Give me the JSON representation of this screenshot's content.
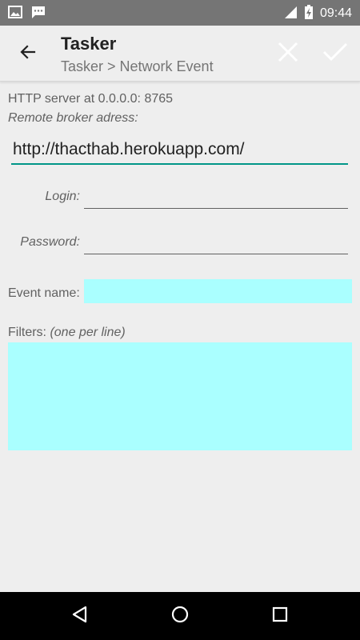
{
  "status_bar": {
    "time": "09:44",
    "left_icons": [
      "image-icon",
      "chat-icon"
    ],
    "right_icons": [
      "signal-icon",
      "battery-charging-icon"
    ]
  },
  "toolbar": {
    "title": "Tasker",
    "subtitle": "Tasker > Network Event",
    "back_icon": "arrow-back-icon",
    "cancel_icon": "close-icon",
    "confirm_icon": "check-icon"
  },
  "form": {
    "server_info": "HTTP server at 0.0.0.0: 8765",
    "broker_label": "Remote broker adress:",
    "broker_url": "http://thacthab.herokuapp.com/",
    "login_label": "Login:",
    "login_value": "",
    "password_label": "Password:",
    "password_value": "",
    "event_name_label": "Event name:",
    "event_name_value": "",
    "filters_label": "Filters:",
    "filters_hint": "(one per line)",
    "filters_value": ""
  },
  "nav_bar": {
    "buttons": [
      "back-triangle-icon",
      "home-circle-icon",
      "recents-square-icon"
    ]
  },
  "colors": {
    "accent": "#009688",
    "input_highlight": "#aaffff",
    "status_bar": "#757575",
    "background": "#eeeeee"
  }
}
